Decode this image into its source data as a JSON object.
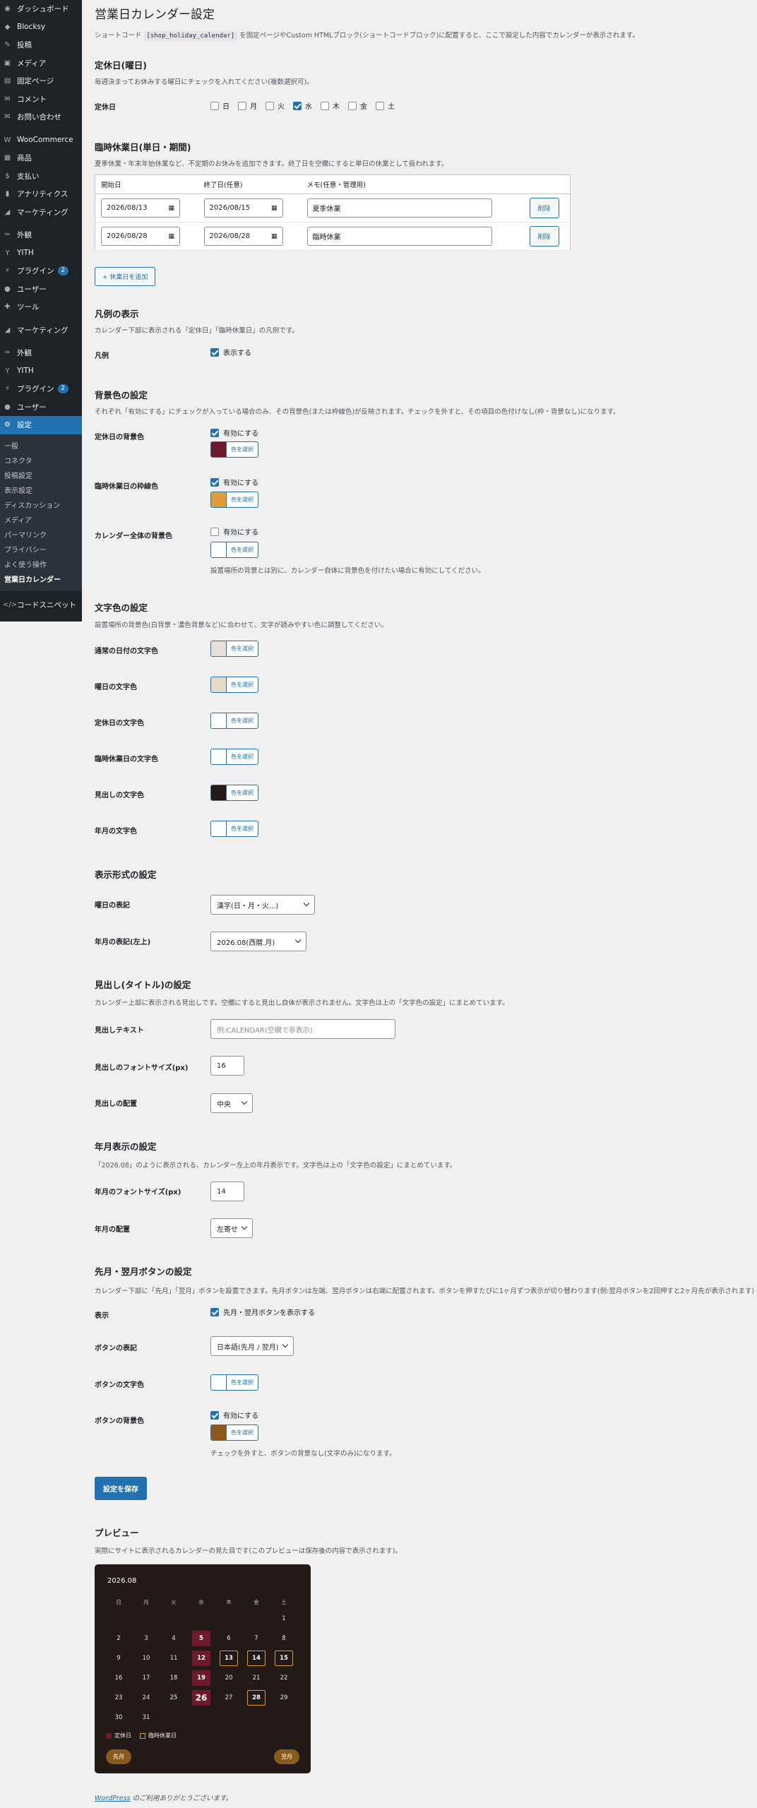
{
  "sidebar": {
    "items": [
      {
        "label": "ダッシュボード",
        "icon": "dashboard-icon"
      },
      {
        "label": "Blocksy",
        "icon": "blocksy-icon"
      },
      {
        "label": "投稿",
        "icon": "pin-icon"
      },
      {
        "label": "メディア",
        "icon": "media-icon"
      },
      {
        "label": "固定ページ",
        "icon": "page-icon"
      },
      {
        "label": "コメント",
        "icon": "comment-icon"
      },
      {
        "label": "お問い合わせ",
        "icon": "mail-icon"
      },
      {
        "label": "WooCommerce",
        "icon": "woo-icon"
      },
      {
        "label": "商品",
        "icon": "product-icon"
      },
      {
        "label": "支払い",
        "icon": "payment-icon"
      },
      {
        "label": "アナリティクス",
        "icon": "analytics-icon"
      },
      {
        "label": "マーケティング",
        "icon": "megaphone-icon"
      },
      {
        "label": "外観",
        "icon": "brush-icon"
      },
      {
        "label": "YITH",
        "icon": "yith-icon"
      },
      {
        "label": "プラグイン",
        "icon": "plugin-icon",
        "badge": "2"
      },
      {
        "label": "ユーザー",
        "icon": "user-icon"
      },
      {
        "label": "ツール",
        "icon": "tool-icon"
      }
    ],
    "items2": [
      {
        "label": "マーケティング",
        "icon": "megaphone-icon"
      },
      {
        "label": "外観",
        "icon": "brush-icon"
      },
      {
        "label": "YITH",
        "icon": "yith-icon"
      },
      {
        "label": "プラグイン",
        "icon": "plugin-icon",
        "badge": "2"
      },
      {
        "label": "ユーザー",
        "icon": "user-icon"
      },
      {
        "label": "設定",
        "icon": "settings-icon"
      }
    ],
    "submenu": [
      "一般",
      "コネクタ",
      "投稿設定",
      "表示設定",
      "ディスカッション",
      "メディア",
      "パーマリンク",
      "プライバシー",
      "よく使う操作",
      "営業日カレンダー"
    ],
    "last": {
      "label": "コードスニペット",
      "icon": "code-icon"
    }
  },
  "page": {
    "title": "営業日カレンダー設定",
    "intro_pre": "ショートコード",
    "intro_code": "[shop_holiday_calendar]",
    "intro_post": "を固定ページやCustom HTMLブロック(ショートコードブロック)に配置すると、ここで設定した内容でカレンダーが表示されます。"
  },
  "weekly": {
    "title": "定休日(曜日)",
    "desc": "毎週決まってお休みする曜日にチェックを入れてください(複数選択可)。",
    "label": "定休日",
    "days": [
      {
        "d": "日",
        "on": false
      },
      {
        "d": "月",
        "on": false
      },
      {
        "d": "火",
        "on": false
      },
      {
        "d": "水",
        "on": true
      },
      {
        "d": "木",
        "on": false
      },
      {
        "d": "金",
        "on": false
      },
      {
        "d": "土",
        "on": false
      }
    ]
  },
  "temp": {
    "title": "臨時休業日(単日・期間)",
    "desc": "夏季休業・年末年始休業など、不定期のお休みを追加できます。終了日を空欄にすると単日の休業として扱われます。",
    "headers": [
      "開始日",
      "終了日(任意)",
      "メモ(任意・管理用)"
    ],
    "rows": [
      {
        "start": "2026/08/13",
        "end": "2026/08/15",
        "memo": "夏季休業",
        "del": "削除"
      },
      {
        "start": "2026/08/28",
        "end": "2026/08/28",
        "memo": "臨時休業",
        "del": "削除"
      }
    ],
    "add": "+ 休業日を追加"
  },
  "legend": {
    "title": "凡例の表示",
    "desc": "カレンダー下部に表示される「定休日」「臨時休業日」の凡例です。",
    "label": "凡例",
    "check": "表示する"
  },
  "bg": {
    "title": "背景色の設定",
    "desc": "それぞれ「有効にする」にチェックが入っている場合のみ、その背景色(または枠線色)が反映されます。チェックを外すと、その項目の色付けなし(枠・背景なし)になります。",
    "rows": [
      {
        "label": "定休日の背景色",
        "check": "有効にする",
        "color": "#6d1a2a"
      },
      {
        "label": "臨時休業日の枠線色",
        "check": "有効にする",
        "color": "#e09c35"
      },
      {
        "label": "カレンダー全体の背景色",
        "check": "有効にする",
        "color": "#ffffff",
        "note": "設置場所の背景とは別に、カレンダー自体に背景色を付けたい場合に有効にしてください。"
      }
    ],
    "pick": "色を選択"
  },
  "text": {
    "title": "文字色の設定",
    "desc": "設置場所の背景色(白背景・濃色背景など)に合わせて、文字が読みやすい色に調整してください。",
    "rows": [
      {
        "label": "通常の日付の文字色",
        "color": "#e8e0d8"
      },
      {
        "label": "曜日の文字色",
        "color": "#e8d8c8"
      },
      {
        "label": "定休日の文字色",
        "color": "#ffffff"
      },
      {
        "label": "臨時休業日の文字色",
        "color": "#ffffff"
      },
      {
        "label": "見出しの文字色",
        "color": "#231a18"
      },
      {
        "label": "年月の文字色",
        "color": "#ffffff"
      }
    ]
  },
  "fmt": {
    "title": "表示形式の設定",
    "dow_label": "曜日の表記",
    "dow_value": "漢字(日・月・火...)",
    "ym_label": "年月の表記(左上)",
    "ym_value": "2026.08(西暦.月)"
  },
  "heading": {
    "title": "見出し(タイトル)の設定",
    "desc": "カレンダー上部に表示される見出しです。空欄にすると見出し自体が表示されません。文字色は上の「文字色の設定」にまとめています。",
    "text_label": "見出しテキスト",
    "text_placeholder": "例:CALENDAR(空欄で非表示)",
    "size_label": "見出しのフォントサイズ(px)",
    "size_value": "16",
    "align_label": "見出しの配置",
    "align_value": "中央"
  },
  "ym": {
    "title": "年月表示の設定",
    "desc": "「2026.08」のように表示される、カレンダー左上の年月表示です。文字色は上の「文字色の設定」にまとめています。",
    "size_label": "年月のフォントサイズ(px)",
    "size_value": "14",
    "align_label": "年月の配置",
    "align_value": "左寄せ"
  },
  "navset": {
    "title": "先月・翌月ボタンの設定",
    "desc": "カレンダー下部に「先月」「翌月」ボタンを設置できます。先月ボタンは左端、翌月ボタンは右端に配置されます。ボタンを押すたびに1ヶ月ずつ表示が切り替わります(例:翌月ボタンを2回押すと2ヶ月先が表示されます)",
    "show_label": "表示",
    "show_check": "先月・翌月ボタンを表示する",
    "style_label": "ボタンの表記",
    "style_value": "日本語(先月 / 翌月)",
    "color_label": "ボタンの文字色",
    "bg_label": "ボタンの背景色",
    "bg_check": "有効にする",
    "bg_note": "チェックを外すと、ボタンの背景なし(文字のみ)になります。",
    "color": "#ffffff",
    "bg_color": "#8a5a1c"
  },
  "save": "設定を保存",
  "preview": {
    "title": "プレビュー",
    "desc": "実際にサイトに表示されるカレンダーの見た目です(このプレビューは保存後の内容で表示されます)。",
    "ym": "2026.08",
    "week": [
      "日",
      "月",
      "火",
      "水",
      "木",
      "金",
      "土"
    ],
    "days": [
      [
        null,
        null,
        null,
        null,
        null,
        null,
        1
      ],
      [
        2,
        3,
        4,
        5,
        6,
        7,
        8
      ],
      [
        9,
        10,
        11,
        12,
        13,
        14,
        15
      ],
      [
        16,
        17,
        18,
        19,
        20,
        21,
        22
      ],
      [
        23,
        24,
        25,
        26,
        27,
        28,
        29
      ],
      [
        30,
        31,
        null,
        null,
        null,
        null,
        null
      ]
    ],
    "regular": [
      5,
      12,
      19,
      26
    ],
    "temporary": [
      13,
      14,
      15,
      28
    ],
    "today": 26,
    "legend_reg": "定休日",
    "legend_tmp": "臨時休業日",
    "prev": "先月",
    "next": "翌月"
  },
  "footer": {
    "link": "WordPress",
    "text": " のご利用ありがとうございます。"
  }
}
